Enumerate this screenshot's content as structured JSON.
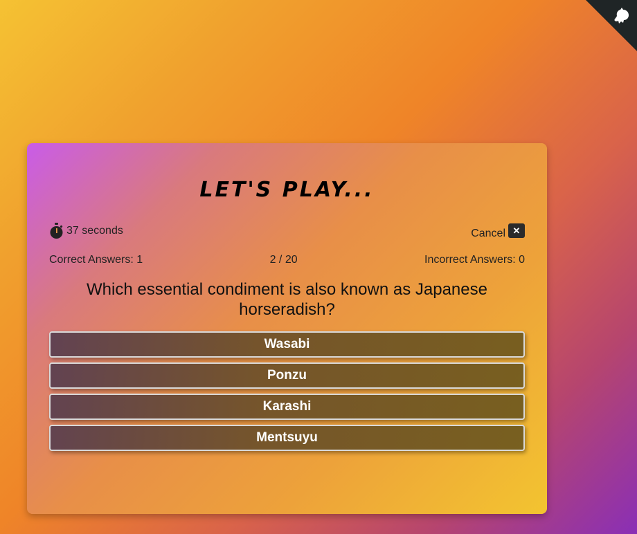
{
  "card": {
    "title": "LET'S PLAY..."
  },
  "timer": {
    "icon": "stopwatch-icon",
    "text": "37 seconds"
  },
  "cancel": {
    "label": "Cancel",
    "icon_text": "✕"
  },
  "stats": {
    "correct": "Correct Answers: 1",
    "progress": "2 / 20",
    "incorrect": "Incorrect Answers: 0"
  },
  "question": "Which essential condiment is also known as Japanese horseradish?",
  "answers": [
    "Wasabi",
    "Ponzu",
    "Karashi",
    "Mentsuyu"
  ],
  "colors": {
    "corner_badge": "#1f2526",
    "answer_border": "#d9d9d9"
  }
}
